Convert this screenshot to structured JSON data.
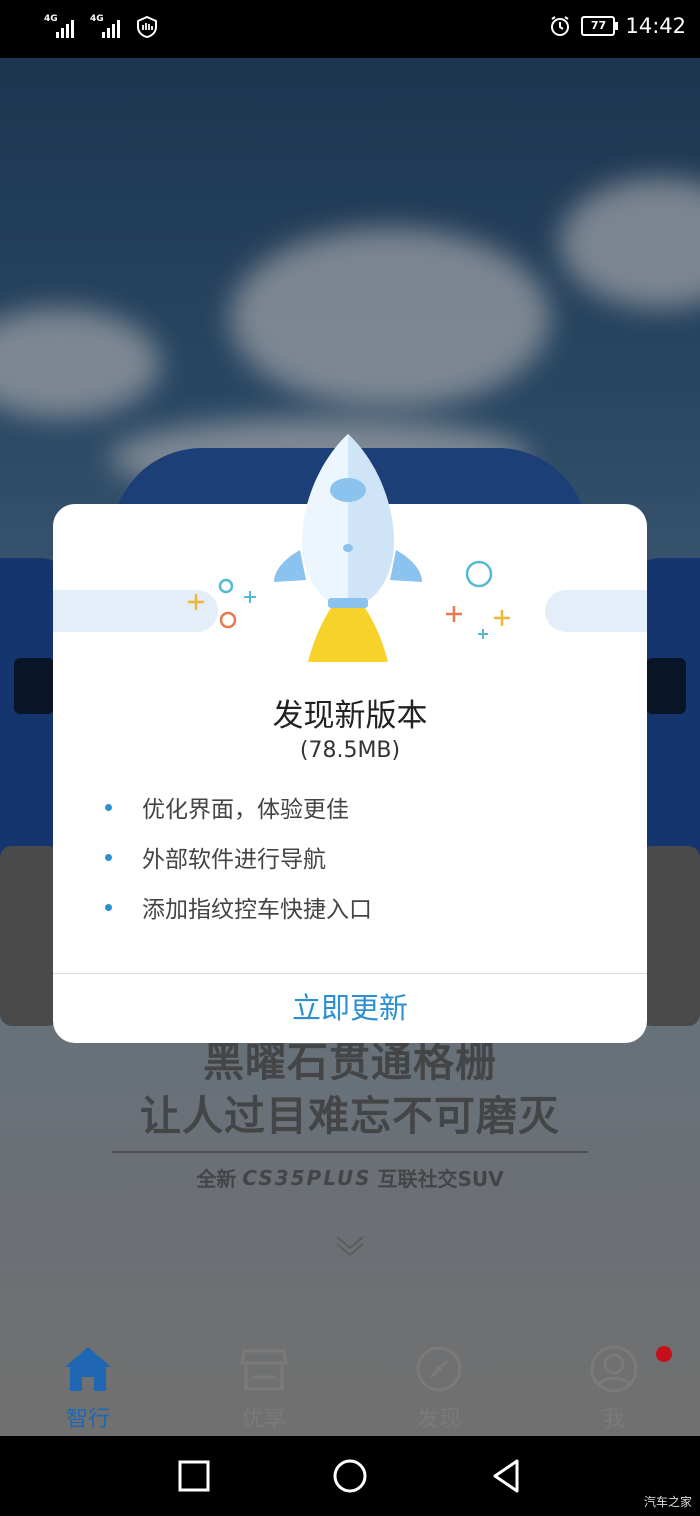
{
  "status_bar": {
    "signal1_label": "4G",
    "signal2_label": "4G",
    "battery": "77",
    "time": "14:42",
    "icons": [
      "signal-icon",
      "signal-icon",
      "shield-icon",
      "alarm-icon",
      "battery-icon"
    ]
  },
  "update_dialog": {
    "title": "发现新版本",
    "size": "(78.5MB)",
    "features": [
      "优化界面，体验更佳",
      "外部软件进行导航",
      "添加指纹控车快捷入口"
    ],
    "button": "立即更新",
    "accent_color": "#2b8fd0",
    "illustration": "rocket-icon"
  },
  "ad": {
    "line1": "黑曜石贯通格栅",
    "line2": "让人过目难忘不可磨灭",
    "tag_prefix": "全新",
    "tag_model": "CS35PLUS",
    "tag_suffix": "互联社交SUV"
  },
  "tabs": [
    {
      "label": "智行",
      "icon": "home-icon",
      "active": true
    },
    {
      "label": "优享",
      "icon": "store-icon",
      "active": false
    },
    {
      "label": "发现",
      "icon": "discover-icon",
      "active": false
    },
    {
      "label": "我",
      "icon": "profile-icon",
      "active": false
    }
  ],
  "colors": {
    "active_tab": "#1f67b3",
    "notification_dot": "#c4101c"
  },
  "watermark": "汽车之家"
}
